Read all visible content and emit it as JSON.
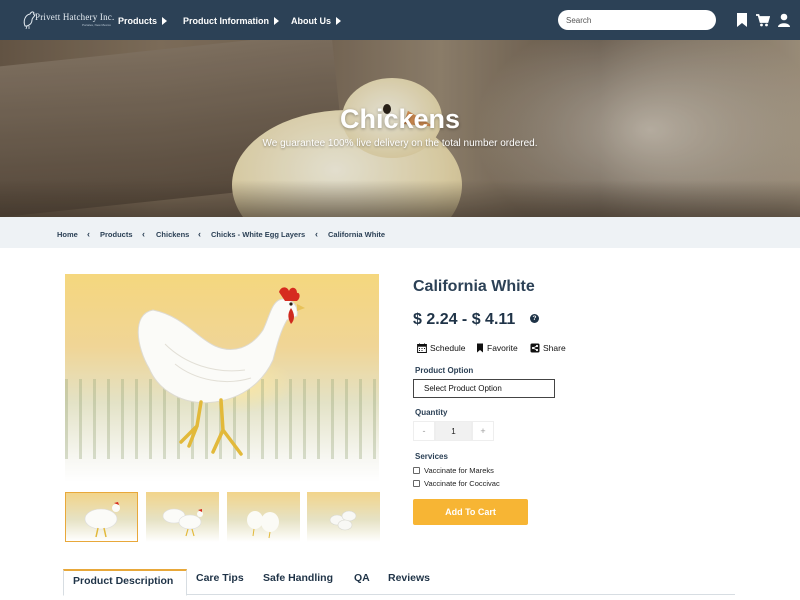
{
  "nav": {
    "logo_text": "Privett Hatchery Inc.",
    "logo_sub": "Portales, New Mexico",
    "menu": [
      {
        "label": "Products"
      },
      {
        "label": "Product Information"
      },
      {
        "label": "About Us"
      }
    ],
    "search_placeholder": "Search",
    "icons": [
      "bookmark-icon",
      "cart-icon",
      "user-icon"
    ]
  },
  "hero": {
    "title": "Chickens",
    "subtitle": "We guarantee 100% live delivery on the total number ordered."
  },
  "breadcrumb": [
    "Home",
    "Products",
    "Chickens",
    "Chicks - White Egg Layers",
    "California White"
  ],
  "product": {
    "title": "California White",
    "price": "$ 2.24 - $ 4.11",
    "actions": [
      "Schedule",
      "Favorite",
      "Share"
    ],
    "option_label": "Product Option",
    "option_selected": "Select Product Option",
    "quantity_label": "Quantity",
    "quantity_value": "1",
    "minus": "-",
    "plus": "+",
    "services_label": "Services",
    "services": [
      "Vaccinate for Mareks",
      "Vaccinate for Coccivac"
    ],
    "add_to_cart": "Add To Cart"
  },
  "tabs": [
    "Product Description",
    "Care Tips",
    "Safe Handling",
    "QA",
    "Reviews"
  ],
  "colors": {
    "nav_bg": "#2c4156",
    "accent": "#f7b534",
    "breadcrumb_bg": "#eef2f5"
  }
}
